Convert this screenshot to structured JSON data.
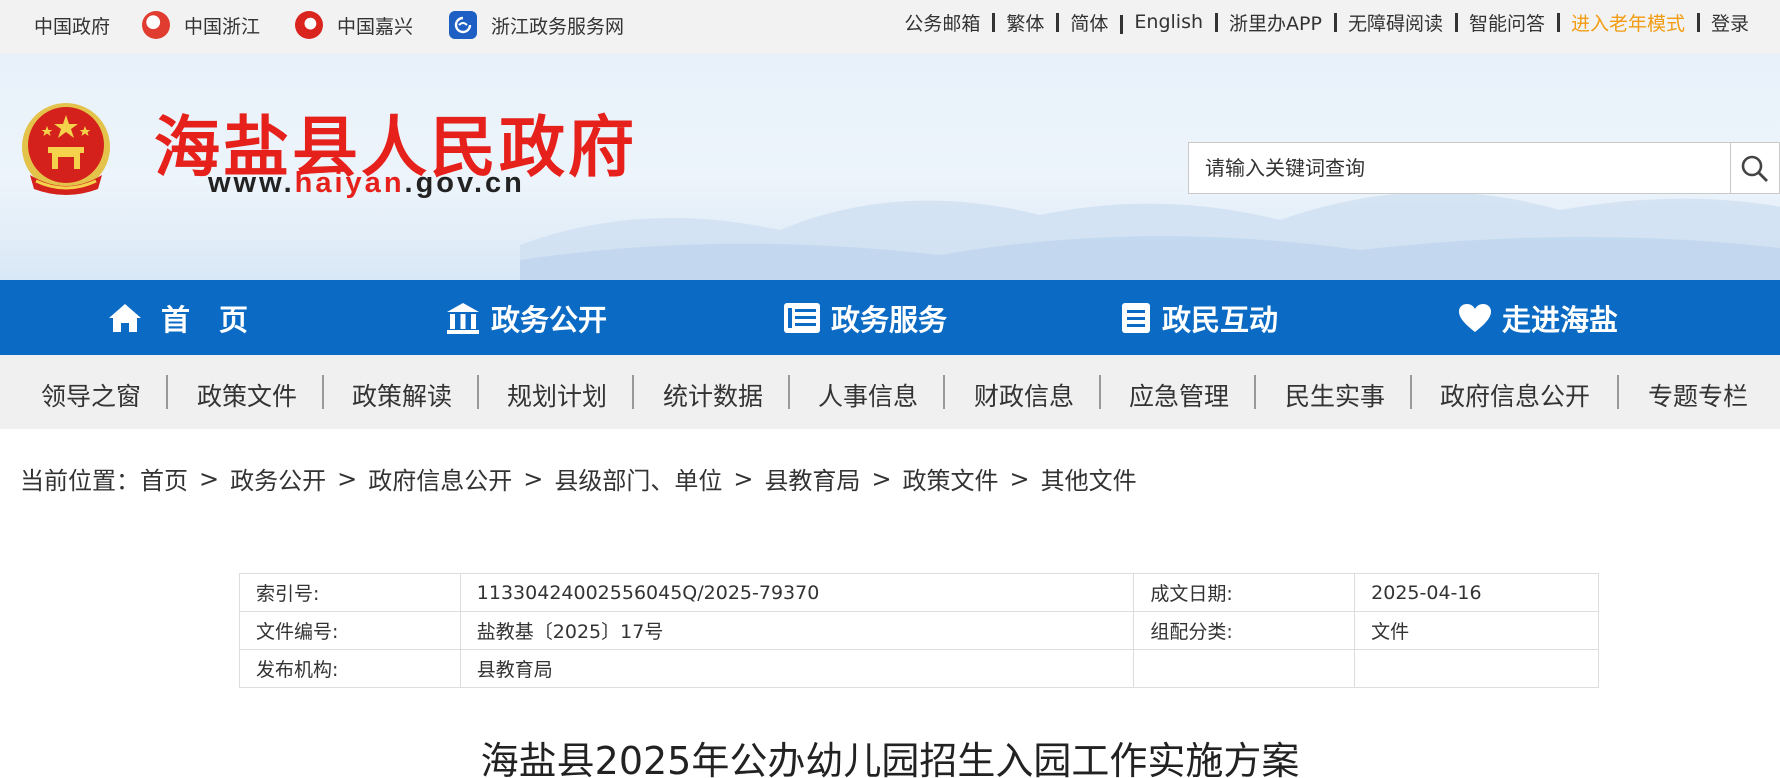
{
  "topbar": {
    "left_links": [
      {
        "label": "中国政府",
        "icon": "none"
      },
      {
        "label": "中国浙江",
        "icon": "zhejiang-logo-icon"
      },
      {
        "label": "中国嘉兴",
        "icon": "jiaxing-logo-icon"
      },
      {
        "label": "浙江政务服务网",
        "icon": "zj-service-logo-icon"
      }
    ],
    "right_links": [
      "公务邮箱",
      "繁体",
      "简体",
      "English",
      "浙里办APP",
      "无障碍阅读",
      "智能问答",
      "进入老年模式",
      "登录"
    ],
    "highlight_color": "#f39c12"
  },
  "header": {
    "site_title": "海盐县人民政府",
    "url_prefix": "www.",
    "url_highlight": "haiyan",
    "url_suffix": ".gov.cn",
    "title_color": "#e6201b"
  },
  "search": {
    "placeholder": "请输入关键词查询",
    "icon": "search-icon"
  },
  "main_nav": {
    "background": "#0b6bc4",
    "items": [
      {
        "label": "首　页",
        "icon": "home-icon"
      },
      {
        "label": "政务公开",
        "icon": "building-icon"
      },
      {
        "label": "政务服务",
        "icon": "list-icon"
      },
      {
        "label": "政民互动",
        "icon": "document-icon"
      },
      {
        "label": "走进海盐",
        "icon": "heart-icon"
      }
    ]
  },
  "sub_nav": {
    "items": [
      "领导之窗",
      "政策文件",
      "政策解读",
      "规划计划",
      "统计数据",
      "人事信息",
      "财政信息",
      "应急管理",
      "民生实事",
      "政府信息公开",
      "专题专栏"
    ]
  },
  "breadcrumb": {
    "prefix": "当前位置：",
    "items": [
      "首页",
      "政务公开",
      "政府信息公开",
      "县级部门、单位",
      "县教育局",
      "政策文件",
      "其他文件"
    ],
    "separator": ">"
  },
  "meta": {
    "index_label": "索引号:",
    "index_value": "11330424002556045Q/2025-79370",
    "date_label": "成文日期:",
    "date_value": "2025-04-16",
    "doc_no_label": "文件编号:",
    "doc_no_value": "盐教基〔2025〕17号",
    "category_label": "组配分类:",
    "category_value": "文件",
    "publisher_label": "发布机构:",
    "publisher_value": "县教育局"
  },
  "document": {
    "title": "海盐县2025年公办幼儿园招生入园工作实施方案"
  }
}
